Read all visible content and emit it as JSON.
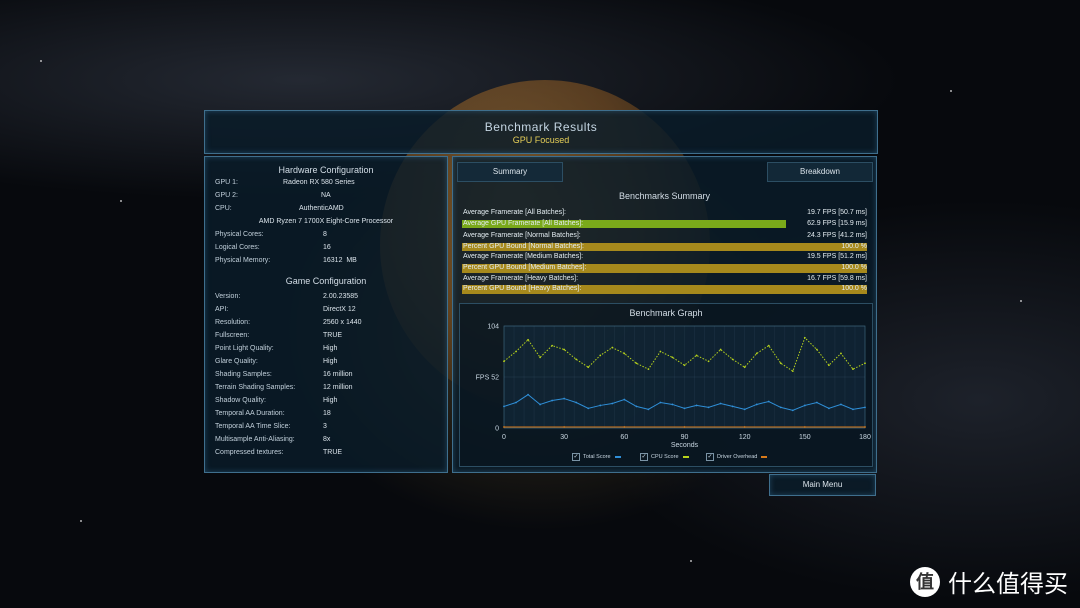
{
  "header": {
    "title": "Benchmark Results",
    "subtitle": "GPU Focused"
  },
  "hardware": {
    "title": "Hardware Configuration",
    "gpu1_label": "GPU 1:",
    "gpu1_value": "Radeon RX 580 Series",
    "gpu2_label": "GPU 2:",
    "gpu2_value": "NA",
    "cpu_label": "CPU:",
    "cpu_vendor": "AuthenticAMD",
    "cpu_name": "AMD Ryzen 7 1700X Eight-Core Processor",
    "phys_cores_label": "Physical Cores:",
    "phys_cores_value": "8",
    "log_cores_label": "Logical Cores:",
    "log_cores_value": "16",
    "mem_label": "Physical Memory:",
    "mem_value": "16312  MB"
  },
  "game": {
    "title": "Game Configuration",
    "rows": [
      {
        "k": "Version:",
        "v": "2.00.23585"
      },
      {
        "k": "API:",
        "v": "DirectX 12"
      },
      {
        "k": "Resolution:",
        "v": "2560 x 1440"
      },
      {
        "k": "Fullscreen:",
        "v": "TRUE"
      },
      {
        "k": "Point Light Quality:",
        "v": "High"
      },
      {
        "k": "Glare Quality:",
        "v": "High"
      },
      {
        "k": "Shading Samples:",
        "v": "16 million"
      },
      {
        "k": "Terrain Shading Samples:",
        "v": "12 million"
      },
      {
        "k": "Shadow Quality:",
        "v": "High"
      },
      {
        "k": "Temporal AA Duration:",
        "v": "18"
      },
      {
        "k": "Temporal AA Time Slice:",
        "v": "3"
      },
      {
        "k": "Multisample Anti-Aliasing:",
        "v": "8x"
      },
      {
        "k": "Compressed textures:",
        "v": "TRUE"
      }
    ]
  },
  "tabs": {
    "summary": "Summary",
    "breakdown": "Breakdown"
  },
  "summary": {
    "title": "Benchmarks Summary",
    "rows": [
      {
        "label": "Average Framerate [All Batches]:",
        "value": "19.7 FPS [50.7 ms]",
        "fill": 0,
        "color": "none"
      },
      {
        "label": "Average GPU Framerate [All Batches]:",
        "value": "62.9 FPS [15.9 ms]",
        "fill": 0.8,
        "color": "#7aa91a"
      },
      {
        "label": "Average Framerate [Normal Batches]:",
        "value": "24.3 FPS [41.2 ms]",
        "fill": 0,
        "color": "none"
      },
      {
        "label": "Percent GPU Bound [Normal Batches]:",
        "value": "100.0 %",
        "fill": 1.0,
        "color": "#a6891c"
      },
      {
        "label": "Average Framerate [Medium Batches]:",
        "value": "19.5 FPS [51.2 ms]",
        "fill": 0,
        "color": "none"
      },
      {
        "label": "Percent GPU Bound [Medium Batches]:",
        "value": "100.0 %",
        "fill": 1.0,
        "color": "#a6891c"
      },
      {
        "label": "Average Framerate [Heavy Batches]:",
        "value": "16.7 FPS [59.8 ms]",
        "fill": 0,
        "color": "none"
      },
      {
        "label": "Percent GPU Bound [Heavy Batches]:",
        "value": "100.0 %",
        "fill": 1.0,
        "color": "#a6891c"
      }
    ]
  },
  "graph": {
    "title": "Benchmark Graph",
    "legend": {
      "total": "Total Score",
      "cpu": "CPU Score",
      "driver": "Driver Overhead"
    }
  },
  "chart_data": {
    "type": "line",
    "title": "Benchmark Graph",
    "xlabel": "Seconds",
    "ylabel": "FPS",
    "xlim": [
      0,
      180
    ],
    "ylim": [
      0,
      104
    ],
    "x_ticks": [
      0,
      30,
      60,
      90,
      120,
      150,
      180
    ],
    "y_ticks": [
      0,
      52,
      104
    ],
    "y_tick_labels": [
      "0",
      "FPS 52",
      "104"
    ],
    "series": [
      {
        "name": "Total Score",
        "color": "#2f8fd8",
        "x": [
          0,
          6,
          12,
          18,
          24,
          30,
          36,
          42,
          48,
          54,
          60,
          66,
          72,
          78,
          84,
          90,
          96,
          102,
          108,
          114,
          120,
          126,
          132,
          138,
          144,
          150,
          156,
          162,
          168,
          174,
          180
        ],
        "values": [
          22,
          26,
          34,
          24,
          28,
          30,
          26,
          20,
          23,
          25,
          29,
          22,
          19,
          26,
          24,
          20,
          23,
          21,
          25,
          22,
          19,
          24,
          27,
          21,
          18,
          23,
          26,
          20,
          24,
          19,
          21
        ]
      },
      {
        "name": "CPU Score",
        "color": "#b7d31c",
        "x": [
          0,
          6,
          12,
          18,
          24,
          30,
          36,
          42,
          48,
          54,
          60,
          66,
          72,
          78,
          84,
          90,
          96,
          102,
          108,
          114,
          120,
          126,
          132,
          138,
          144,
          150,
          156,
          162,
          168,
          174,
          180
        ],
        "values": [
          68,
          78,
          90,
          72,
          84,
          80,
          70,
          62,
          74,
          82,
          76,
          66,
          60,
          78,
          72,
          64,
          74,
          68,
          80,
          70,
          62,
          76,
          84,
          66,
          58,
          92,
          80,
          64,
          76,
          60,
          66
        ]
      },
      {
        "name": "Driver Overhead",
        "color": "#d87a1a",
        "x": [
          0,
          30,
          60,
          90,
          120,
          150,
          180
        ],
        "values": [
          1,
          1,
          1,
          1,
          1,
          1,
          1
        ]
      }
    ],
    "grid": true,
    "legend_position": "bottom"
  },
  "buttons": {
    "main_menu": "Main Menu"
  },
  "watermark": {
    "badge": "值",
    "text": "什么值得买"
  }
}
